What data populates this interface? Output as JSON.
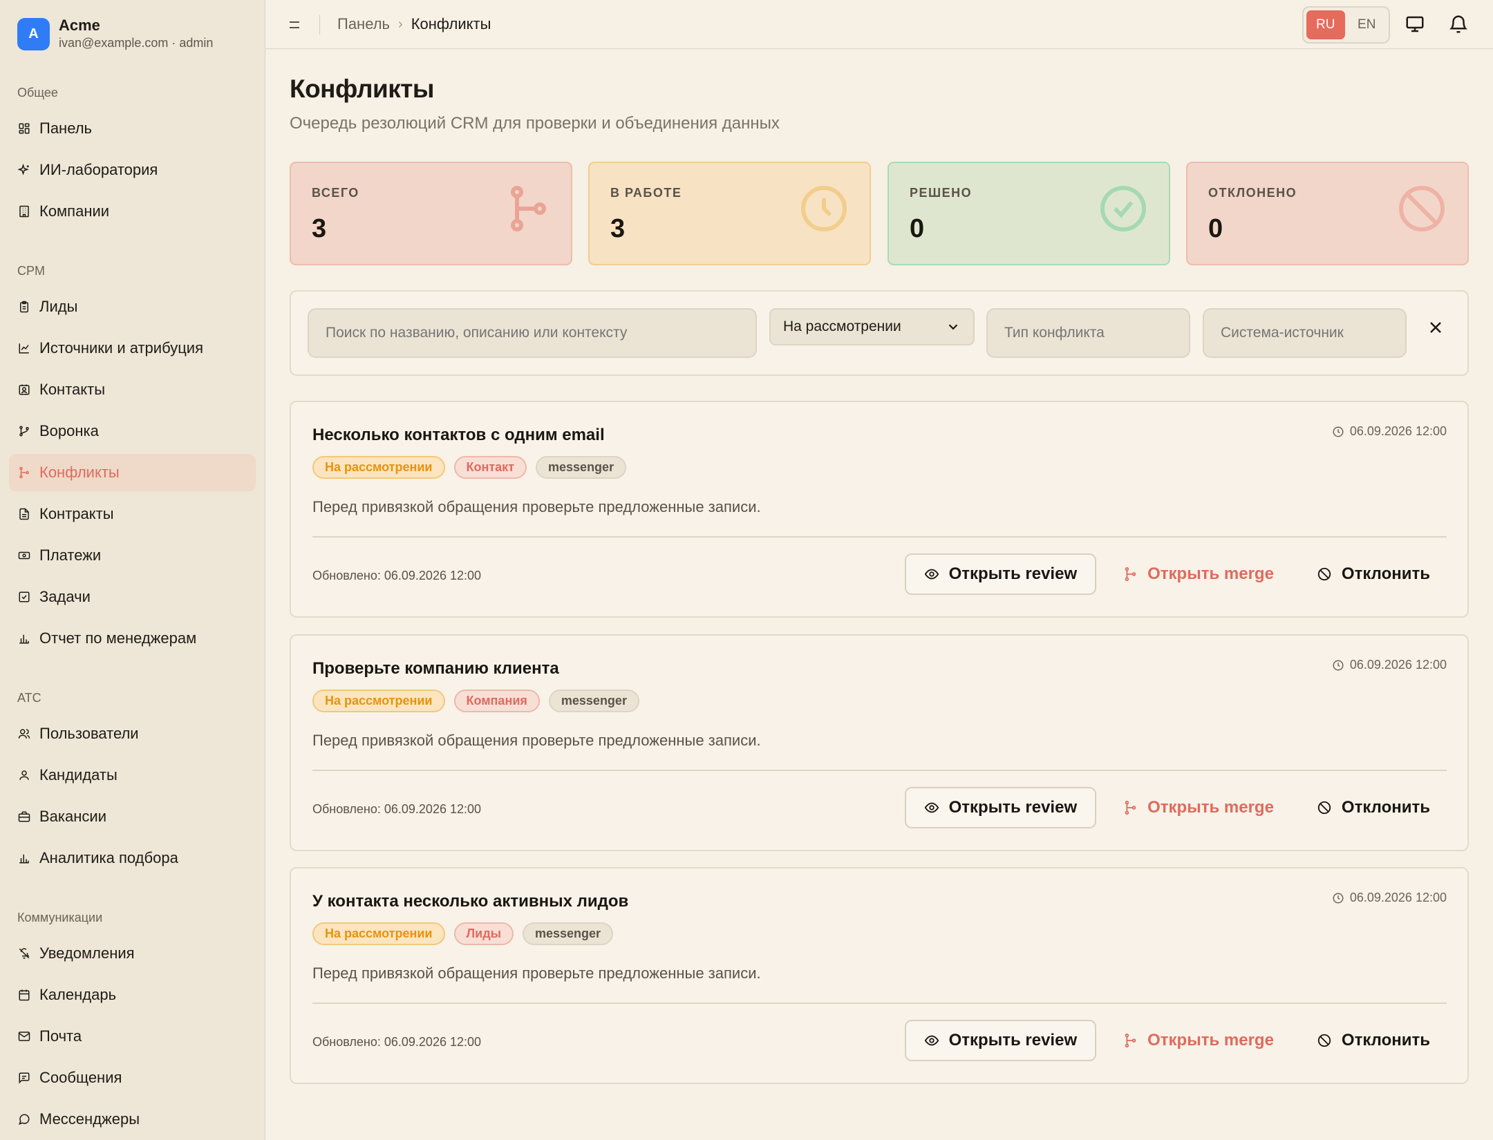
{
  "account": {
    "avatar_letter": "A",
    "name": "Acme",
    "email_role": "ivan@example.com · admin",
    "avatar_color": "#2f7cf6"
  },
  "sidebar": {
    "sections": [
      {
        "label": "Общее",
        "items": [
          {
            "label": "Панель",
            "icon": "grid-icon"
          },
          {
            "label": "ИИ-лаборатория",
            "icon": "sparkles-icon"
          },
          {
            "label": "Компании",
            "icon": "building-icon"
          }
        ]
      },
      {
        "label": "CPM",
        "items": [
          {
            "label": "Лиды",
            "icon": "clipboard-icon"
          },
          {
            "label": "Источники и атрибуция",
            "icon": "chart-line-icon"
          },
          {
            "label": "Контакты",
            "icon": "contact-card-icon"
          },
          {
            "label": "Воронка",
            "icon": "git-branch-icon"
          },
          {
            "label": "Конфликты",
            "icon": "merge-icon",
            "active": true
          },
          {
            "label": "Контракты",
            "icon": "file-icon"
          },
          {
            "label": "Платежи",
            "icon": "banknote-icon"
          },
          {
            "label": "Задачи",
            "icon": "checkbox-icon"
          },
          {
            "label": "Отчет по менеджерам",
            "icon": "bar-chart-icon"
          }
        ]
      },
      {
        "label": "ATC",
        "items": [
          {
            "label": "Пользователи",
            "icon": "users-icon"
          },
          {
            "label": "Кандидаты",
            "icon": "user-icon"
          },
          {
            "label": "Вакансии",
            "icon": "briefcase-icon"
          },
          {
            "label": "Аналитика подбора",
            "icon": "bar-chart-icon"
          }
        ]
      },
      {
        "label": "Коммуникации",
        "items": [
          {
            "label": "Уведомления",
            "icon": "bell-off-icon"
          },
          {
            "label": "Календарь",
            "icon": "calendar-icon"
          },
          {
            "label": "Почта",
            "icon": "mail-icon"
          },
          {
            "label": "Сообщения",
            "icon": "message-square-icon"
          },
          {
            "label": "Мессенджеры",
            "icon": "message-circle-icon"
          }
        ]
      }
    ]
  },
  "topbar": {
    "breadcrumb_parent": "Панель",
    "breadcrumb_separator": "›",
    "breadcrumb_current": "Конфликты",
    "lang_ru": "RU",
    "lang_en": "EN",
    "active_lang": "RU"
  },
  "page": {
    "title": "Конфликты",
    "subtitle": "Очередь резолюций CRM для проверки и объединения данных"
  },
  "stats": {
    "total": {
      "label": "ВСЕГО",
      "value": "3",
      "icon": "merge-icon"
    },
    "in_work": {
      "label": "В РАБОТЕ",
      "value": "3",
      "icon": "clock-icon"
    },
    "resolved": {
      "label": "РЕШЕНО",
      "value": "0",
      "icon": "check-circle-icon"
    },
    "rejected": {
      "label": "ОТКЛОНЕНО",
      "value": "0",
      "icon": "ban-icon"
    }
  },
  "filters": {
    "search_placeholder": "Поиск по названию, описанию или контексту",
    "status_value": "На рассмотрении",
    "type_placeholder": "Тип конфликта",
    "source_placeholder": "Система-источник"
  },
  "conflicts": [
    {
      "title": "Несколько контактов с одним email",
      "time": "06.09.2026 12:00",
      "status": "На рассмотрении",
      "entity": "Контакт",
      "source": "messenger",
      "description": "Перед привязкой обращения проверьте предложенные записи.",
      "updated": "Обновлено: 06.09.2026 12:00"
    },
    {
      "title": "Проверьте компанию клиента",
      "time": "06.09.2026 12:00",
      "status": "На рассмотрении",
      "entity": "Компания",
      "source": "messenger",
      "description": "Перед привязкой обращения проверьте предложенные записи.",
      "updated": "Обновлено: 06.09.2026 12:00"
    },
    {
      "title": "У контакта несколько активных лидов",
      "time": "06.09.2026 12:00",
      "status": "На рассмотрении",
      "entity": "Лиды",
      "source": "messenger",
      "description": "Перед привязкой обращения проверьте предложенные записи.",
      "updated": "Обновлено: 06.09.2026 12:00"
    }
  ],
  "actions": {
    "open_review": "Открыть review",
    "open_merge": "Открыть merge",
    "reject": "Отклонить"
  },
  "colors": {
    "accent": "#e56b5d",
    "status_pending": "#e8930c",
    "success": "#4bbf6b"
  }
}
